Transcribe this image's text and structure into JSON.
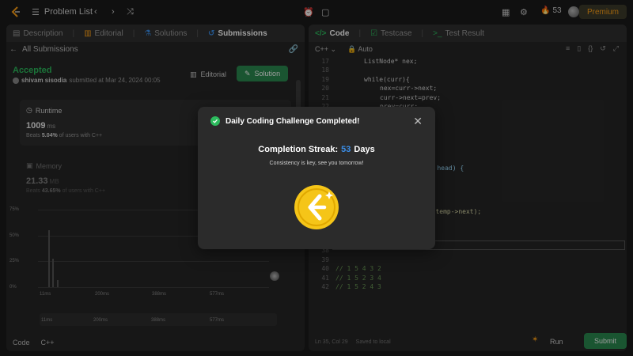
{
  "topbar": {
    "problem_list": "Problem List",
    "streak_count": "53",
    "premium": "Premium"
  },
  "left_tabs": {
    "description": "Description",
    "editorial": "Editorial",
    "solutions": "Solutions",
    "submissions": "Submissions"
  },
  "submission": {
    "all_submissions": "All Submissions",
    "status": "Accepted",
    "user": "shivam sisodia",
    "submitted_text": "submitted at Mar 24, 2024 00:05",
    "editorial_btn": "Editorial",
    "solution_btn": "Solution"
  },
  "runtime": {
    "label": "Runtime",
    "value": "1009",
    "unit": "ms",
    "beats_prefix": "Beats",
    "beats_pct": "5.04%",
    "beats_suffix": "of users with C++"
  },
  "memory": {
    "label": "Memory",
    "value": "21.33",
    "unit": "MB",
    "beats_prefix": "Beats",
    "beats_pct": "43.65%",
    "beats_suffix": "of users with C++"
  },
  "chart": {
    "y_ticks": [
      "75%",
      "50%",
      "25%",
      "0%"
    ],
    "x_ticks": [
      "11ms",
      "200ms",
      "388ms",
      "577ms"
    ],
    "mini_ticks": [
      "11ms",
      "200ms",
      "388ms",
      "577ms"
    ]
  },
  "bottom_left": {
    "code": "Code",
    "lang": "C++"
  },
  "right_tabs": {
    "code": "Code",
    "testcase": "Testcase",
    "result": "Test Result"
  },
  "editor": {
    "language": "C++",
    "mode": "Auto",
    "lines": [
      {
        "n": "17",
        "text": "ListNode* nex;"
      },
      {
        "n": "18",
        "text": ""
      },
      {
        "n": "19",
        "text": "while(curr){"
      },
      {
        "n": "20",
        "text": "nex=curr->next;"
      },
      {
        "n": "21",
        "text": "curr->next=prev;"
      },
      {
        "n": "22",
        "text": "prev=curr;"
      },
      {
        "n": "23",
        "text": ""
      },
      {
        "n": "24",
        "text": ""
      },
      {
        "n": "25",
        "text": ""
      },
      {
        "n": "26",
        "text": ""
      },
      {
        "n": "27",
        "text": ""
      },
      {
        "n": "28",
        "text": ""
      },
      {
        "n": "29",
        "text": ""
      },
      {
        "n": "30",
        "text": ""
      },
      {
        "n": "31",
        "text": ""
      },
      {
        "n": "32",
        "text": ""
      },
      {
        "n": "33",
        "text": ""
      },
      {
        "n": "34",
        "text": ""
      },
      {
        "n": "35",
        "text": ""
      },
      {
        "n": "36",
        "text": ""
      },
      {
        "n": "37",
        "text": ""
      },
      {
        "n": "38",
        "text": ""
      },
      {
        "n": "39",
        "text": ""
      },
      {
        "n": "40",
        "text": "// 1 5 4 3 2"
      },
      {
        "n": "41",
        "text": "// 1 5 2 3 4"
      },
      {
        "n": "42",
        "text": "// 1 5 2 4 3"
      }
    ],
    "fragment_head": "e* head) {",
    "fragment_temp": "se(temp->next);",
    "status_pos": "Ln 35, Col 29",
    "status_saved": "Saved to local",
    "run": "Run",
    "submit": "Submit"
  },
  "modal": {
    "title": "Daily Coding Challenge Completed!",
    "streak_prefix": "Completion Streak:",
    "streak_number": "53",
    "streak_suffix": "Days",
    "subtitle": "Consistency is key, see you tomorrow!"
  },
  "colors": {
    "accent_green": "#2cbb5d",
    "streak_blue": "#3b8ee8",
    "premium_orange": "#ffa116",
    "coin_gold": "#f5c518"
  }
}
